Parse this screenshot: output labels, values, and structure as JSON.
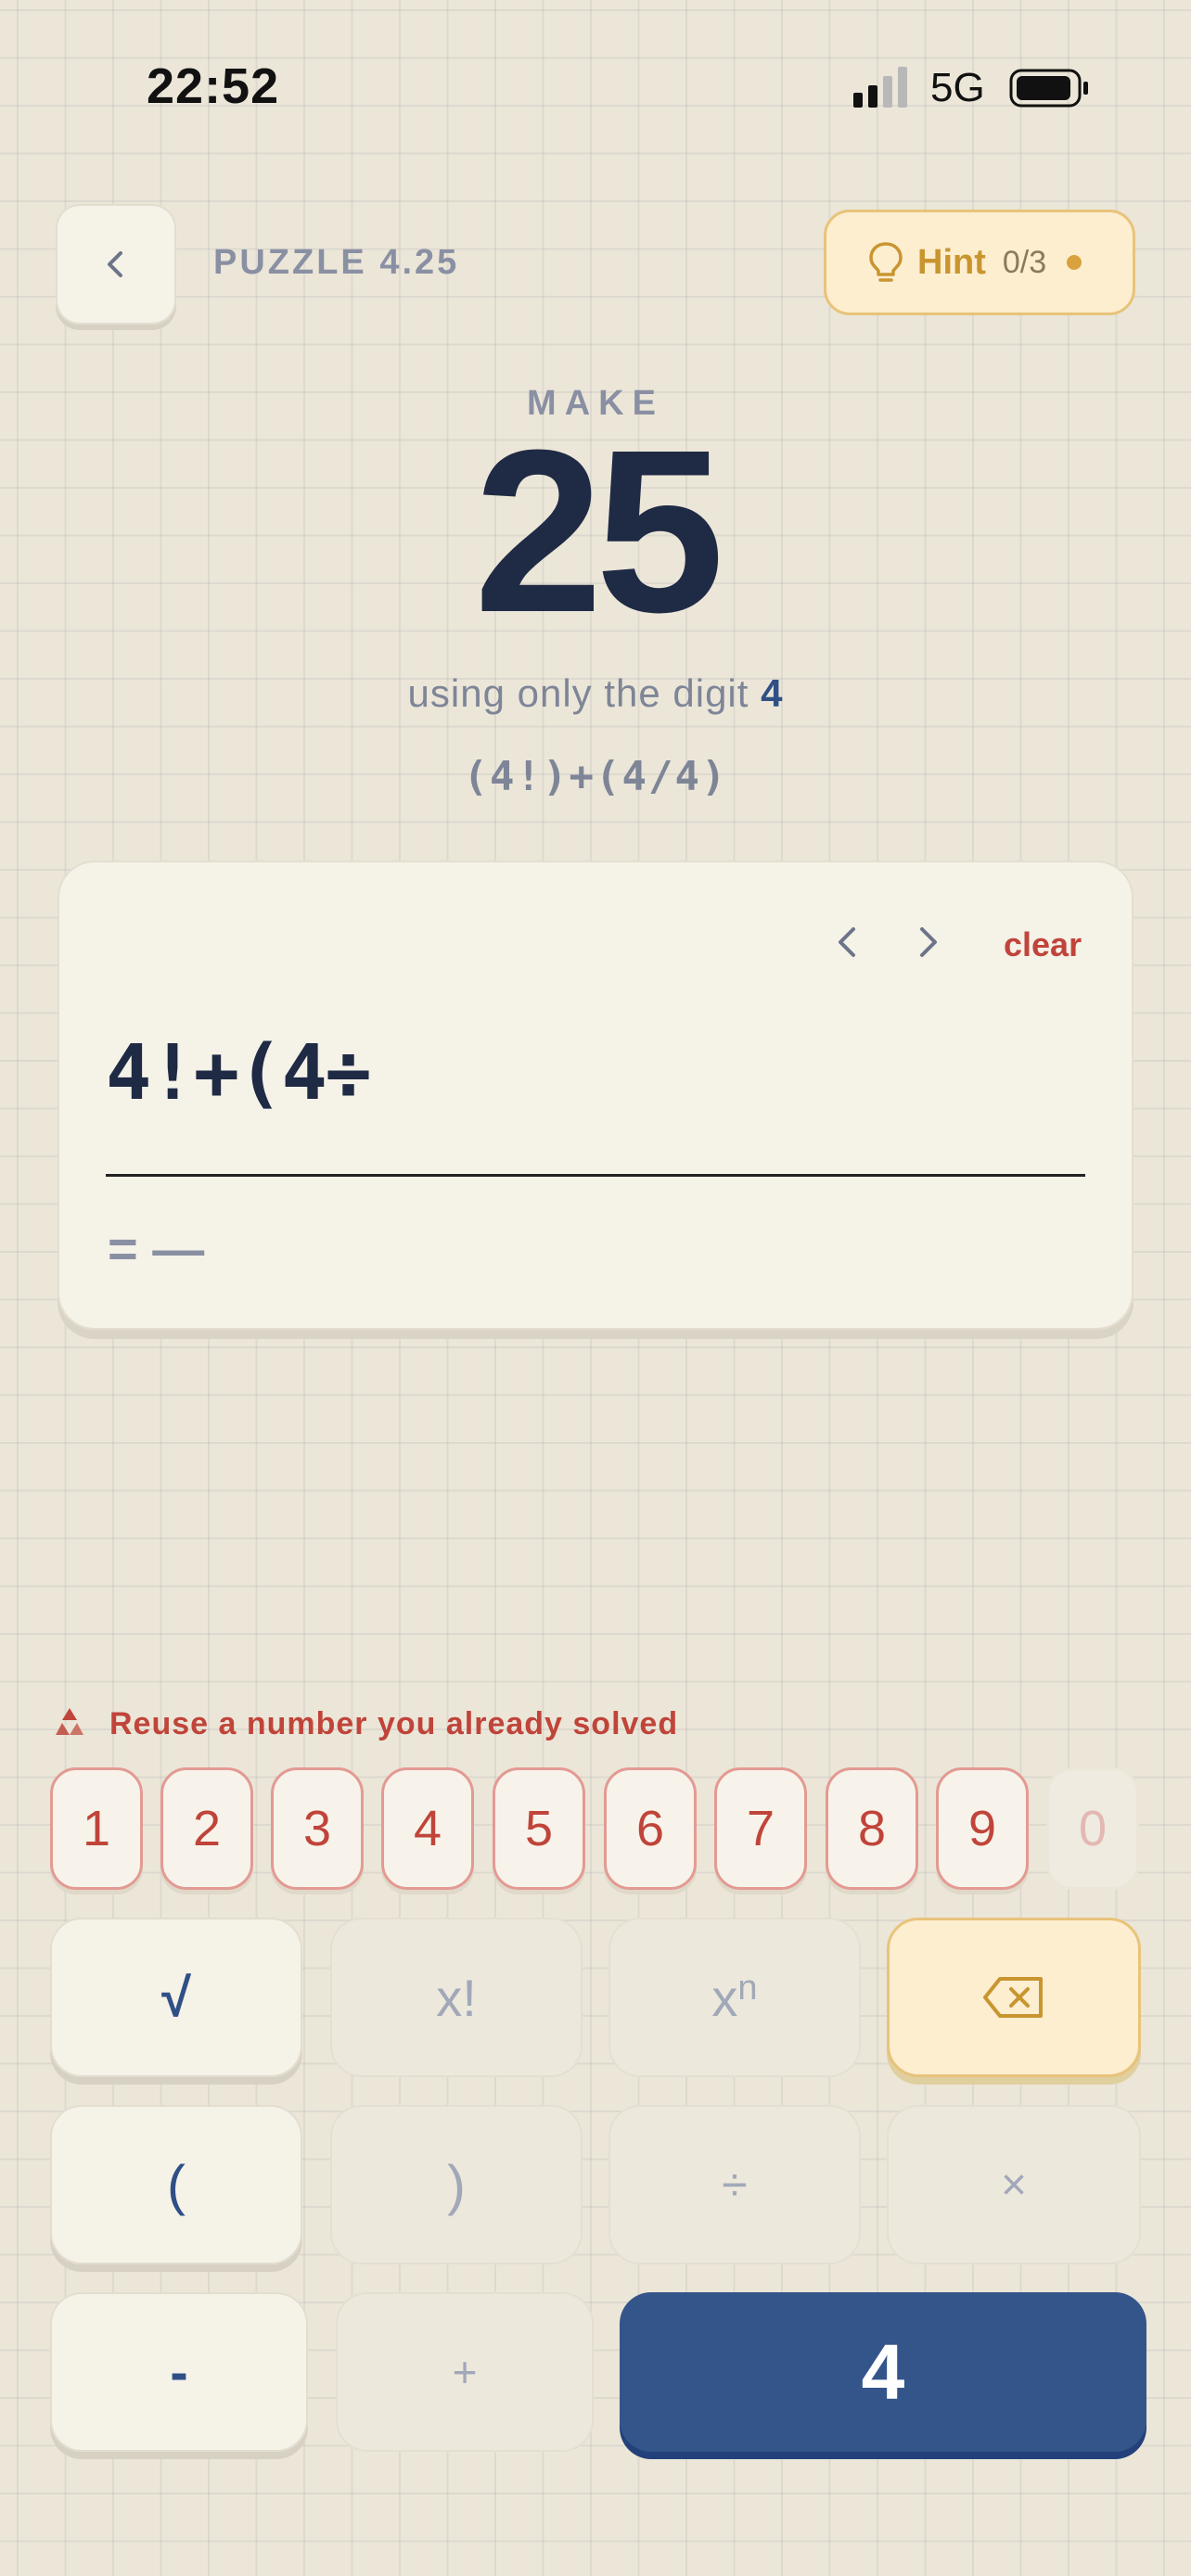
{
  "status_bar": {
    "time": "22:52",
    "network": "5G",
    "icons": [
      "signal-icon",
      "battery-icon"
    ]
  },
  "header": {
    "puzzle_title": "PUZZLE 4.25",
    "hint_label": "Hint",
    "hint_count": "0/3",
    "back_icon": "chevron-left-icon",
    "hint_icon": "lightbulb-icon"
  },
  "target": {
    "make_label": "MAKE",
    "number": "25",
    "using_prefix": "using only the digit",
    "digit": "4",
    "solution_display": "(4!)+(4/4)"
  },
  "editor": {
    "expression": "4!+(4÷",
    "clear_label": "clear",
    "result_prefix": "=",
    "result_value": "—"
  },
  "reuse": {
    "text": "Reuse a number you already solved",
    "icon": "recycle-icon"
  },
  "number_chips": [
    "1",
    "2",
    "3",
    "4",
    "5",
    "6",
    "7",
    "8",
    "9",
    "0"
  ],
  "keypad": {
    "sqrt": "√",
    "factorial": "x!",
    "power_base": "x",
    "power_exp": "n",
    "open_paren": "(",
    "close_paren": ")",
    "divide": "÷",
    "multiply": "×",
    "minus": "-",
    "plus": "+",
    "digit": "4",
    "delete_icon": "backspace-icon"
  },
  "colors": {
    "accent_blue": "#34558a",
    "accent_red": "#c0443a",
    "hint_gold": "#c8952f",
    "text_dark": "#1f2a44"
  }
}
